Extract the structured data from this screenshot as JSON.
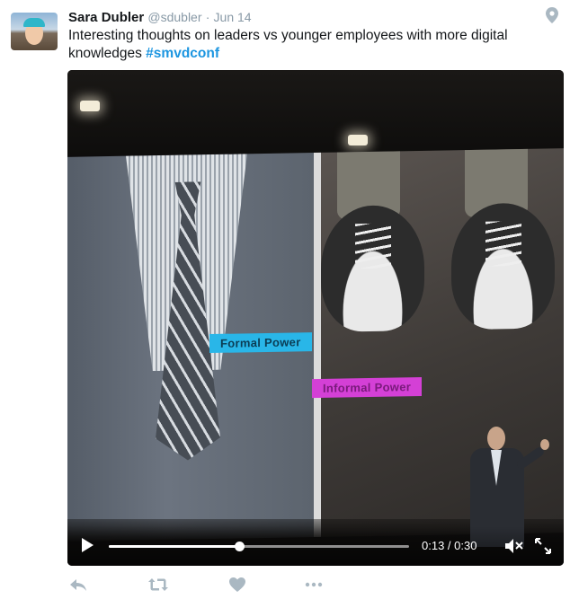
{
  "tweet": {
    "author_name": "Sara Dubler",
    "handle": "@sdubler",
    "separator": "·",
    "date": "Jun 14",
    "text": "Interesting thoughts on leaders vs younger employees with more digital knowledges ",
    "hashtag": "#smvdconf",
    "icons": {
      "location": "location-pin-icon"
    }
  },
  "video": {
    "slide_labels": {
      "formal": "Formal Power",
      "informal": "Informal Power"
    },
    "progress": 0.433,
    "time_display": "0:13 / 0:30",
    "icons": {
      "play": "play-icon",
      "mute": "mute-icon",
      "fullscreen": "fullscreen-icon"
    }
  },
  "actions": {
    "icons": [
      "reply-icon",
      "retweet-icon",
      "like-icon",
      "more-icon"
    ]
  },
  "colors": {
    "hashtag": "#1b95e0",
    "muted": "#8899a6",
    "action_icon": "#aab8c2",
    "formal_label": "#29b6e8",
    "informal_label": "#d440d6"
  }
}
